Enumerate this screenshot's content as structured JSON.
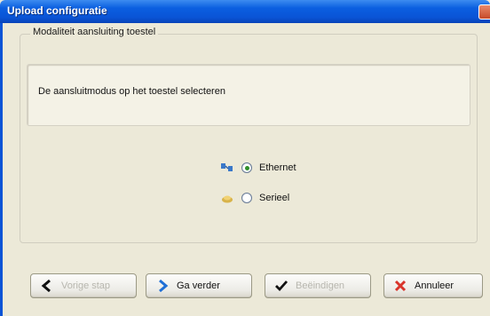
{
  "window": {
    "title": "Upload configuratie"
  },
  "group": {
    "legend": "Modaliteit aansluiting toestel"
  },
  "description": "De aansluitmodus op het toestel selecteren",
  "options": [
    {
      "label": "Ethernet",
      "checked": true,
      "icon": "network-icon"
    },
    {
      "label": "Serieel",
      "checked": false,
      "icon": "serial-icon"
    }
  ],
  "buttons": {
    "back": {
      "label": "Vorige stap",
      "enabled": false,
      "icon": "arrow-left-icon"
    },
    "next": {
      "label": "Ga verder",
      "enabled": true,
      "icon": "arrow-right-icon"
    },
    "finish": {
      "label": "Beëindigen",
      "enabled": false,
      "icon": "checkmark-icon"
    },
    "cancel": {
      "label": "Annuleer",
      "enabled": true,
      "icon": "cancel-x-icon"
    }
  },
  "colors": {
    "titlebar": "#0a54d6",
    "window_bg": "#ece9d8",
    "next_arrow": "#1f6fd6",
    "cancel_x": "#d9342b"
  }
}
